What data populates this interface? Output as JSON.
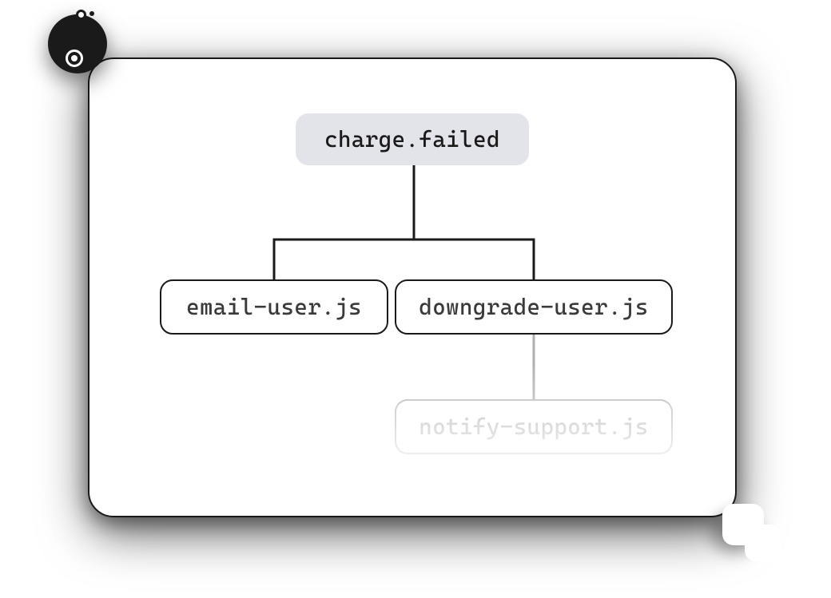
{
  "diagram": {
    "root": {
      "label": "charge.failed"
    },
    "children": [
      {
        "label": "email-user.js"
      },
      {
        "label": "downgrade-user.js"
      }
    ],
    "grandchild": {
      "label": "notify-support.js"
    }
  }
}
